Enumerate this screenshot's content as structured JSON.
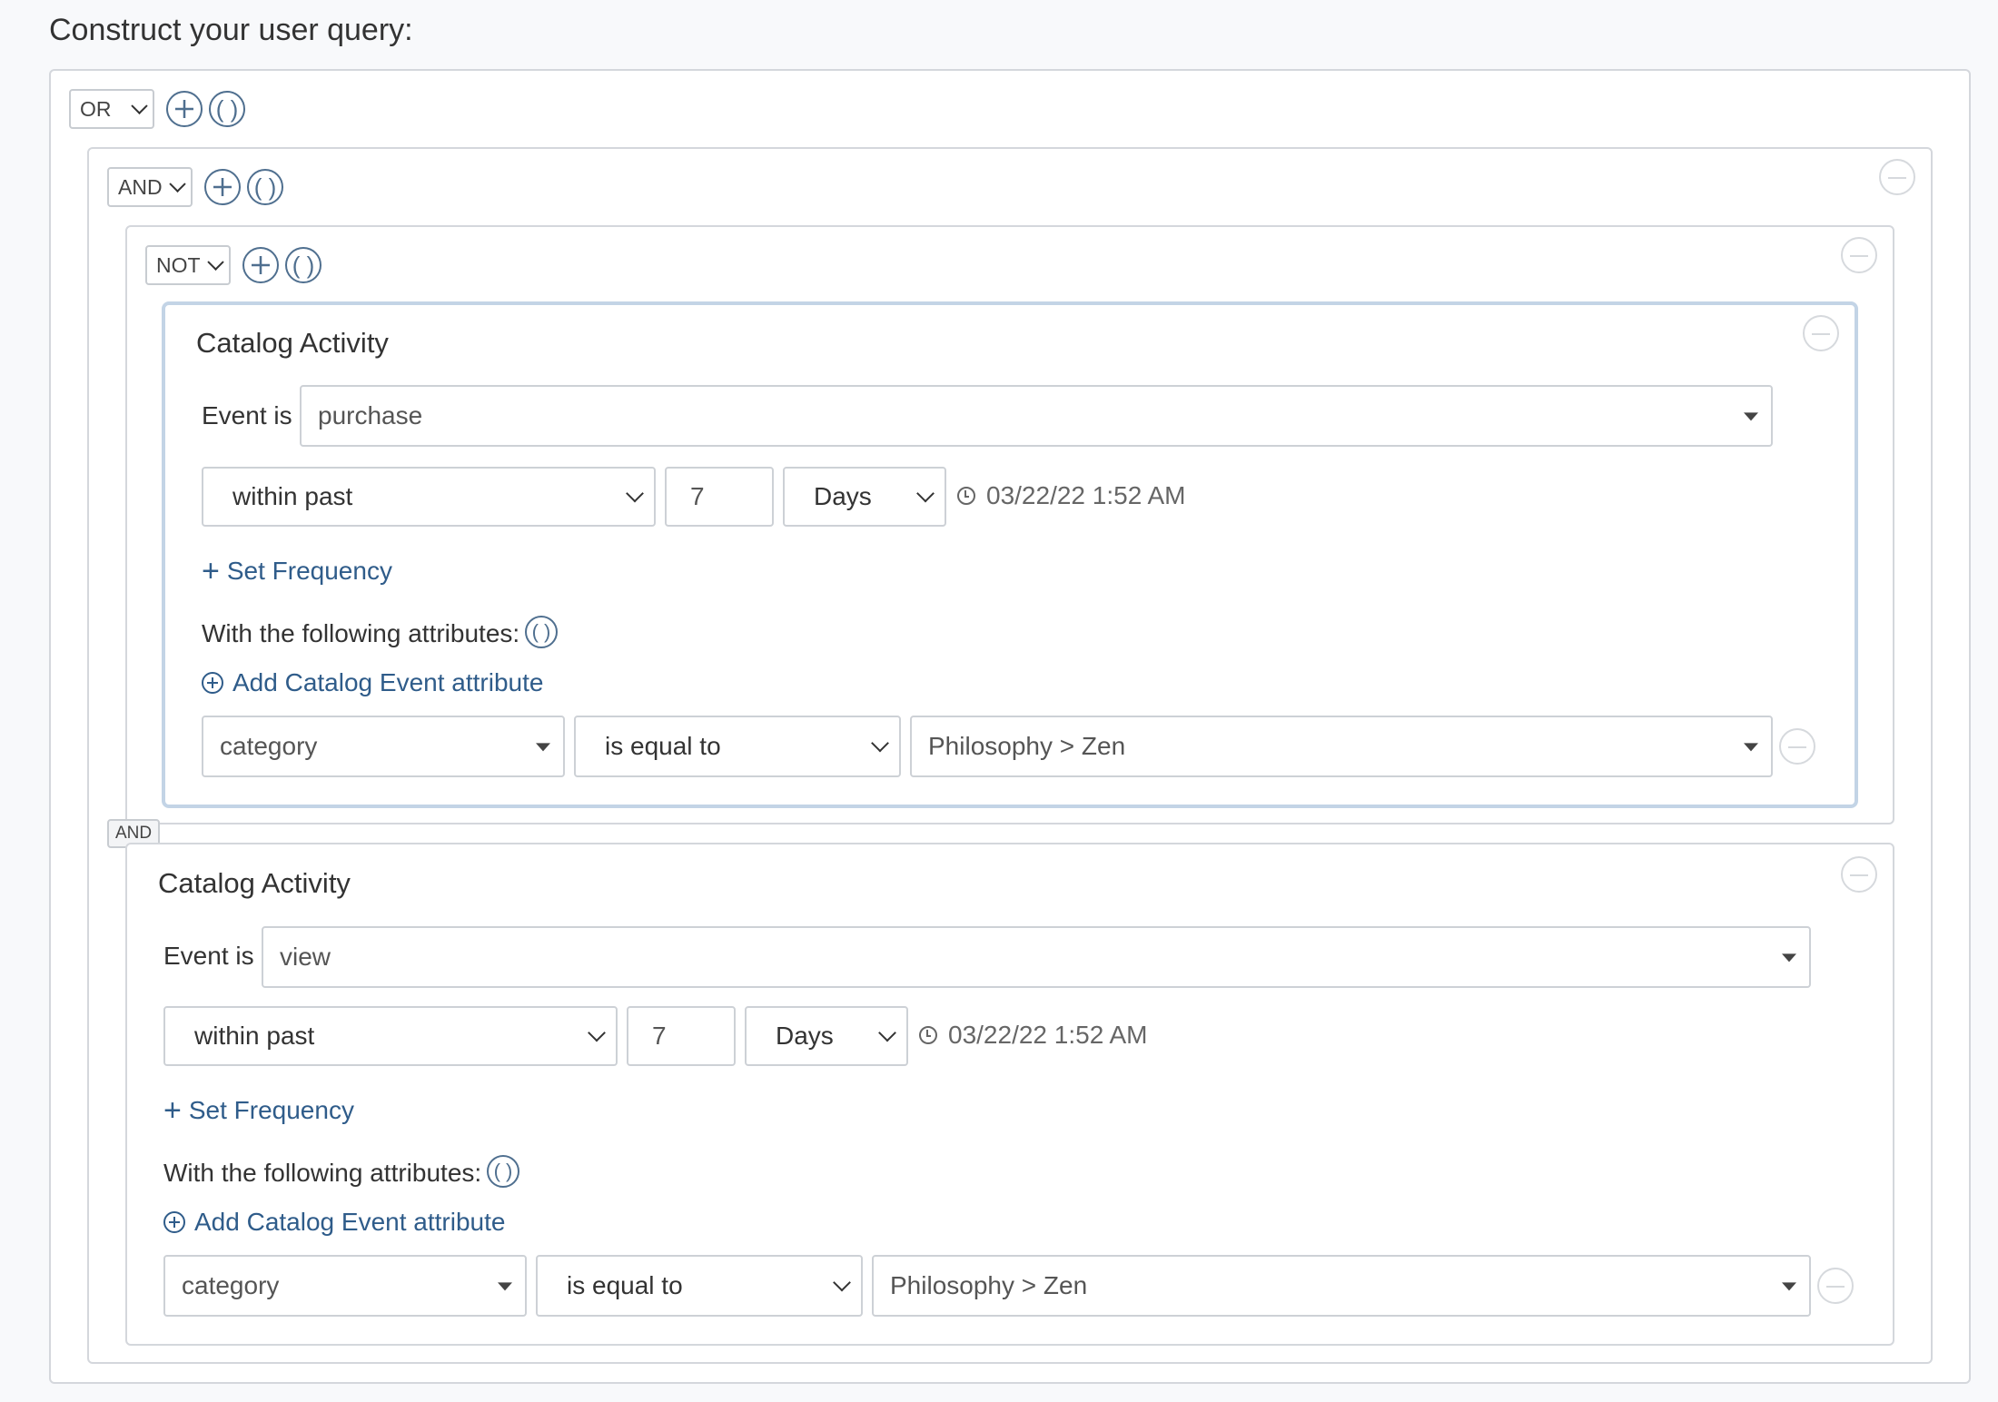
{
  "title": "Construct your user query:",
  "root": {
    "operator": "OR"
  },
  "group_and": {
    "operator": "AND"
  },
  "group_not": {
    "operator": "NOT"
  },
  "connector": "AND",
  "cards": [
    {
      "title": "Catalog Activity",
      "event_label": "Event is",
      "event_value": "purchase",
      "time_mode": "within past",
      "time_value": "7",
      "time_unit": "Days",
      "date": "03/22/22 1:52 AM",
      "set_frequency": "Set Frequency",
      "attributes_label": "With the following attributes:",
      "add_attribute": "Add Catalog Event attribute",
      "attr_name": "category",
      "attr_op": "is equal to",
      "attr_value": "Philosophy > Zen"
    },
    {
      "title": "Catalog Activity",
      "event_label": "Event is",
      "event_value": "view",
      "time_mode": "within past",
      "time_value": "7",
      "time_unit": "Days",
      "date": "03/22/22 1:52 AM",
      "set_frequency": "Set Frequency",
      "attributes_label": "With the following attributes:",
      "add_attribute": "Add Catalog Event attribute",
      "attr_name": "category",
      "attr_op": "is equal to",
      "attr_value": "Philosophy > Zen"
    }
  ],
  "icons": {
    "add": "plus-circle-icon",
    "group": "parentheses-icon",
    "remove": "minus-circle-icon",
    "clock": "clock-icon"
  },
  "colors": {
    "accent": "#2f5c8a",
    "icon": "#4f6f8f",
    "border": "#d4d7dc",
    "selected_border": "#c3d4e6"
  }
}
